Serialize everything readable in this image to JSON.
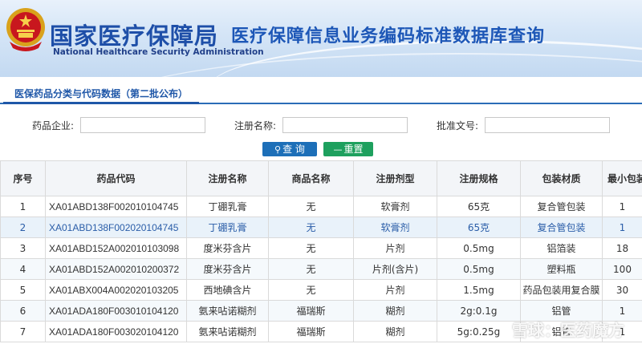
{
  "header": {
    "title": "国家医疗保障局",
    "subtitle": "医疗保障信息业务编码标准数据库查询",
    "english": "National Healthcare Security Administration"
  },
  "section": {
    "tab_label": "医保药品分类与代码数据（第二批公布）"
  },
  "search": {
    "company_label": "药品企业:",
    "company_value": "",
    "reg_name_label": "注册名称:",
    "reg_name_value": "",
    "approval_label": "批准文号:",
    "approval_value": "",
    "query_label": "查 询",
    "reset_label": "重置"
  },
  "table": {
    "columns": [
      "序号",
      "药品代码",
      "注册名称",
      "商品名称",
      "注册剂型",
      "注册规格",
      "包装材质",
      "最小包装"
    ],
    "rows": [
      [
        "1",
        "XA01ABD138F002010104745",
        "丁硼乳膏",
        "无",
        "软膏剂",
        "65克",
        "复合管包装",
        "1"
      ],
      [
        "2",
        "XA01ABD138F002020104745",
        "丁硼乳膏",
        "无",
        "软膏剂",
        "65克",
        "复合管包装",
        "1"
      ],
      [
        "3",
        "XA01ABD152A002010103098",
        "度米芬含片",
        "无",
        "片剂",
        "0.5mg",
        "铝箔装",
        "18"
      ],
      [
        "4",
        "XA01ABD152A002010200372",
        "度米芬含片",
        "无",
        "片剂(含片)",
        "0.5mg",
        "塑料瓶",
        "100"
      ],
      [
        "5",
        "XA01ABX004A002020103205",
        "西地碘含片",
        "无",
        "片剂",
        "1.5mg",
        "药品包装用复合膜",
        "30"
      ],
      [
        "6",
        "XA01ADA180F003010104120",
        "氨来呫诺糊剂",
        "福瑞斯",
        "糊剂",
        "2g:0.1g",
        "铝管",
        "1"
      ],
      [
        "7",
        "XA01ADA180F003020104120",
        "氨来呫诺糊剂",
        "福瑞斯",
        "糊剂",
        "5g:0.25g",
        "铝管",
        "1"
      ]
    ]
  },
  "watermark": "雪球：医药魔方",
  "colors": {
    "brand_blue": "#1e4fa8",
    "query_button": "#1d6fb8",
    "reset_button": "#1ea05e",
    "highlight_row_text": "#2a5da8"
  }
}
